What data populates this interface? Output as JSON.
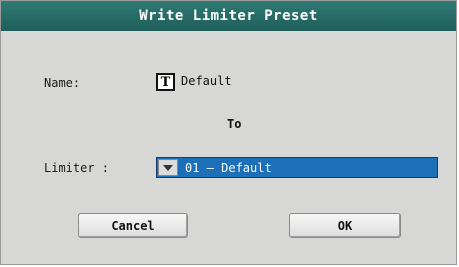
{
  "dialog": {
    "title": "Write Limiter Preset",
    "name_label": "Name:",
    "name_value": "Default",
    "name_icon_glyph": "T",
    "to_label": "To",
    "limiter_label": "Limiter :",
    "limiter_value": "01 – Default",
    "cancel_label": "Cancel",
    "ok_label": "OK"
  },
  "icons": {
    "text_edit": "text-edit-icon",
    "dropdown": "chevron-down-icon"
  },
  "colors": {
    "titlebar": "#1f5e5a",
    "dialog_bg": "#d7d7d5",
    "selected_field": "#1d6fb8"
  }
}
